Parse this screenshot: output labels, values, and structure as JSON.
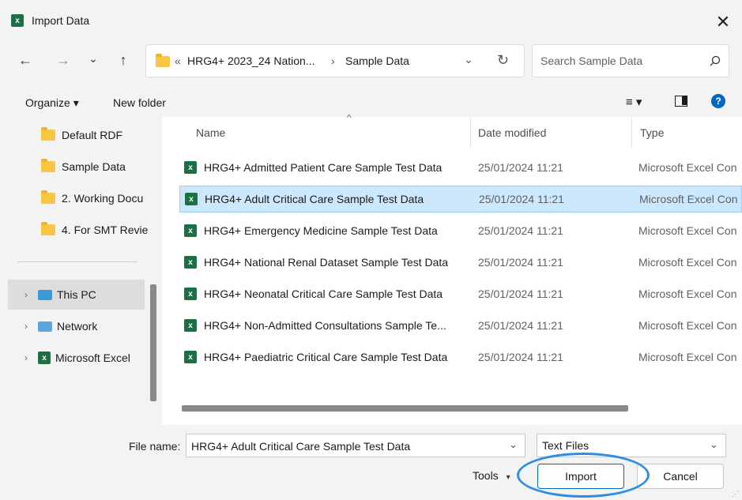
{
  "window": {
    "title": "Import Data",
    "app_icon_letter": "x",
    "close_glyph": "✕"
  },
  "nav": {
    "back_glyph": "←",
    "forward_glyph": "→",
    "recent_glyph": "⌄",
    "up_glyph": "↑",
    "address_prefix": "«",
    "address_parent": "HRG4+ 2023_24 Nation...",
    "address_sep": "›",
    "address_current": "Sample Data",
    "refresh_glyph": "↻",
    "search_placeholder": "Search Sample Data"
  },
  "toolbar": {
    "organize_label": "Organize ▾",
    "new_folder_label": "New folder",
    "view_glyph": "≡ ▾",
    "help_glyph": "?"
  },
  "sidebar": {
    "items": [
      {
        "label": "Default RDF",
        "icon": "folder-icon"
      },
      {
        "label": "Sample Data",
        "icon": "folder-icon"
      },
      {
        "label": "2. Working Docu",
        "icon": "folder-icon"
      },
      {
        "label": "4. For SMT Revie",
        "icon": "folder-icon"
      },
      {
        "label": "This PC",
        "icon": "computer-icon"
      },
      {
        "label": "Network",
        "icon": "network-icon"
      },
      {
        "label": "Microsoft Excel",
        "icon": "excel-icon"
      }
    ]
  },
  "filelist": {
    "headers": {
      "name": "Name",
      "date": "Date modified",
      "type": "Type"
    },
    "rows": [
      {
        "name": "HRG4+ Admitted Patient Care Sample Test Data",
        "date": "25/01/2024 11:21",
        "type": "Microsoft Excel Con"
      },
      {
        "name": "HRG4+ Adult Critical Care Sample Test Data",
        "date": "25/01/2024 11:21",
        "type": "Microsoft Excel Con"
      },
      {
        "name": "HRG4+ Emergency Medicine Sample Test Data",
        "date": "25/01/2024 11:21",
        "type": "Microsoft Excel Con"
      },
      {
        "name": "HRG4+ National Renal Dataset Sample Test Data",
        "date": "25/01/2024 11:21",
        "type": "Microsoft Excel Con"
      },
      {
        "name": "HRG4+ Neonatal Critical Care Sample Test Data",
        "date": "25/01/2024 11:21",
        "type": "Microsoft Excel Con"
      },
      {
        "name": "HRG4+ Non-Admitted Consultations Sample Te...",
        "date": "25/01/2024 11:21",
        "type": "Microsoft Excel Con"
      },
      {
        "name": "HRG4+ Paediatric Critical Care Sample Test Data",
        "date": "25/01/2024 11:21",
        "type": "Microsoft Excel Con"
      }
    ]
  },
  "footer": {
    "file_name_label": "File name:",
    "file_name_value": "HRG4+ Adult Critical Care Sample Test Data",
    "file_type_value": "Text Files",
    "tools_label": "Tools",
    "import_label": "Import",
    "cancel_label": "Cancel"
  },
  "colors": {
    "accent": "#0067c0",
    "selection": "#cce8ff",
    "highlight_oval": "#2f8ee0",
    "excel_green": "#1d7044"
  }
}
